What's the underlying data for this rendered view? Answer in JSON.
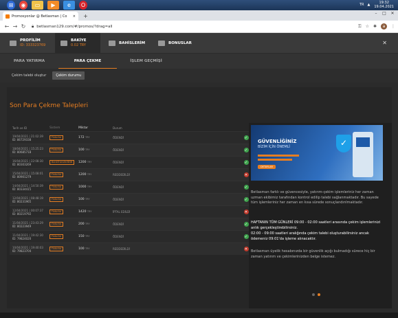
{
  "taskbar": {
    "tray_lang": "TR",
    "time": "19:32",
    "date": "19.04.2021",
    "icons": [
      "windows-start",
      "chrome",
      "file-explorer",
      "media-player",
      "internet-explorer",
      "opera"
    ]
  },
  "browser": {
    "tab_title": "Promosyonlar @ Betlasman | Co",
    "tab_close": "×",
    "new_tab": "+",
    "url": "betlasman129.com/#/promos/?drag=all",
    "profile_initial": "a"
  },
  "header": {
    "profile_title": "PROFİLİM",
    "profile_id": "ID: 333323769",
    "balance_title": "BAKİYE",
    "balance_value": "0.02 TRY",
    "bonuses_title": "BAHİSLERİM",
    "offers_title": "BONUSLAR"
  },
  "subtabs": [
    "PARA YATIRMA",
    "PARA ÇEKME",
    "İŞLEM GEÇMİŞİ"
  ],
  "operations": [
    "Çekim talebi oluştur",
    "Çekim durumu"
  ],
  "page_title": "Son Para Çekme Talepleri",
  "table": {
    "headers": [
      "Tarih ve ID",
      "Sistem",
      "Miktar",
      "Durum"
    ],
    "id_prefix": "ID:",
    "currency": "TRY",
    "rows": [
      {
        "date": "19/04/2021 | 21:02:39",
        "id": "86729338",
        "system": "Fixturka",
        "amount": "172",
        "status": "ÖDENDİ",
        "ok": true
      },
      {
        "date": "18/04/2021 | 15:25:23",
        "id": "80685718",
        "system": "Fixturka",
        "amount": "100",
        "status": "ÖDENDİ",
        "ok": true
      },
      {
        "date": "16/04/2021 | 22:08:30",
        "id": "80303269",
        "system": "BankTransferBNB",
        "amount": "1200",
        "status": "ÖDENDİ",
        "ok": true
      },
      {
        "date": "15/04/2021 | 15:08:01",
        "id": "80901279",
        "system": "Fixturka",
        "amount": "1200",
        "status": "REDDEDİLDİ",
        "ok": false
      },
      {
        "date": "14/04/2021 | 14:50:39",
        "id": "80334415",
        "system": "Fixturka",
        "amount": "1000",
        "status": "ÖDENDİ",
        "ok": true
      },
      {
        "date": "12/04/2021 | 08:48:19",
        "id": "80231965",
        "system": "Fixturka",
        "amount": "100",
        "status": "ÖDENDİ",
        "ok": true
      },
      {
        "date": "12/04/2021 | 00:07:37",
        "id": "80219792",
        "system": "Fixturka",
        "amount": "1420",
        "status": "İPTAL EDİLDİ",
        "ok": false
      },
      {
        "date": "11/04/2021 | 23:43:29",
        "id": "80223949",
        "system": "Fixturka",
        "amount": "200",
        "status": "ÖDENDİ",
        "ok": true
      },
      {
        "date": "11/04/2021 | 19:42:30",
        "id": "79824020",
        "system": "Fixturka",
        "amount": "150",
        "status": "ÖDENDİ",
        "ok": true
      },
      {
        "date": "10/04/2021 | 19:40:03",
        "id": "79823704",
        "system": "Fixturka",
        "amount": "100",
        "status": "REDDEDİLDİ",
        "ok": false
      }
    ]
  },
  "promo": {
    "banner_title_1": "GÜVENLİĞİNİZ",
    "banner_title_2": "BİZİM İÇİN ÖNEMLİ",
    "banner_button": "DETAYLAR",
    "para1": "Betlasman farklı ve güvencesiyle, yatırım-çekim işlemleriniz her zaman uzman ekibimiz tarafından kontrol edilip talebi sağlanmaktadır. Bu sayede tüm işlemleriniz her zaman en kısa sürede sonuçlandırılmaktadır.",
    "para2": "HAFTANIN TÜM GÜNLERİ 09:00 - 02:00 saatleri arasında çekim işlemlerinizi anlık gerçekleştirebilirsiniz.",
    "para3": "02:00 - 09:00 saatleri aralığında çekim talebi oluşturabilirsiniz ancak ödemeniz 09:01'da işleme alınacaktır.",
    "para4": "Betlasman üyelik hesabınızda bir güvenlik açığı bulmadığı sürece hiç bir zaman yatırım ve çekimlerinizden belge istemez."
  },
  "colors": {
    "accent": "#e67e22",
    "success": "#3fa34d",
    "danger": "#c0392b"
  }
}
